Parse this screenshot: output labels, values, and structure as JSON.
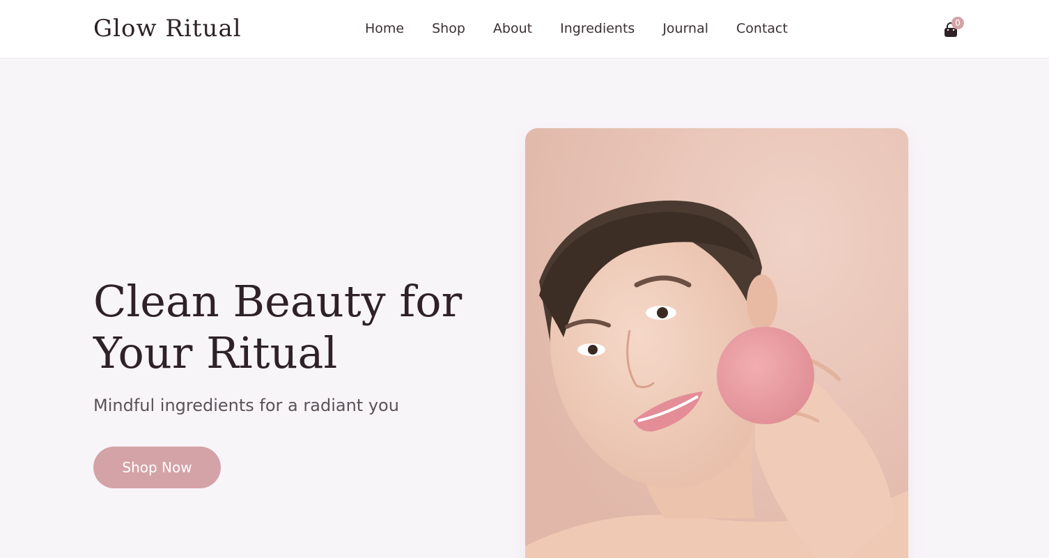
{
  "brand": {
    "name": "Glow Ritual"
  },
  "nav": {
    "items": [
      "Home",
      "Shop",
      "About",
      "Ingredients",
      "Journal",
      "Contact"
    ]
  },
  "cart": {
    "count": "0",
    "icon": "shopping-bag-icon"
  },
  "hero": {
    "title_line1": "Clean Beauty for",
    "title_line2": "Your Ritual",
    "subtitle": "Mindful ingredients for a radiant you",
    "cta_label": "Shop Now",
    "image_alt": "Woman applying a pink konjac sponge to her cheek"
  },
  "colors": {
    "accent": "#d4a3a7",
    "background": "#f8f5f9",
    "text": "#2e2226"
  }
}
